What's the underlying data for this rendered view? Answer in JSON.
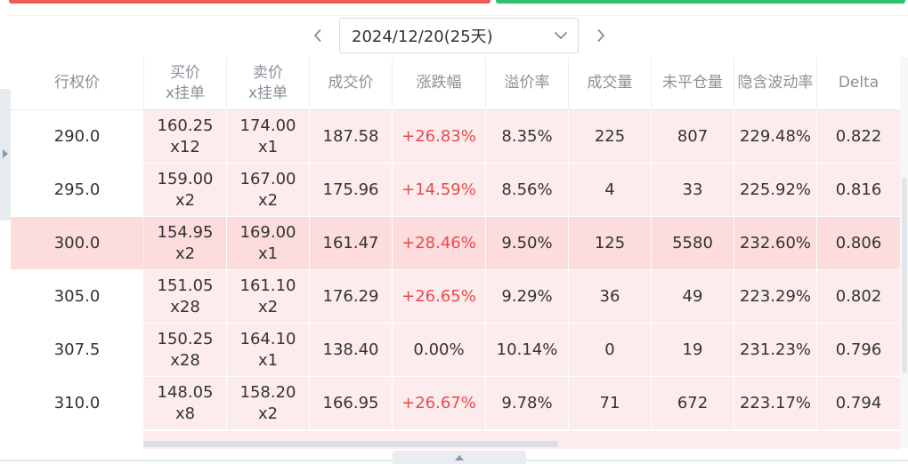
{
  "date_selector": {
    "value": "2024/12/20(25天)"
  },
  "colors": {
    "up": "#e84a4a",
    "row_bg": "#fdeced",
    "atm_bg": "#fcdcdc",
    "header_text": "#8b8f99"
  },
  "icons": {
    "prev": "chevron-left-icon",
    "next": "chevron-right-icon",
    "dropdown": "chevron-down-icon",
    "expand": "caret-up-icon",
    "side": "caret-right-icon"
  },
  "table": {
    "headers": [
      [
        "行权价"
      ],
      [
        "买价",
        "x挂单"
      ],
      [
        "卖价",
        "x挂单"
      ],
      [
        "成交价"
      ],
      [
        "涨跌幅"
      ],
      [
        "溢价率"
      ],
      [
        "成交量"
      ],
      [
        "未平仓量"
      ],
      [
        "隐含波动率"
      ],
      [
        "Delta"
      ]
    ],
    "rows": [
      {
        "strike": "290.0",
        "bid": "160.25",
        "bid_size": "x12",
        "ask": "174.00",
        "ask_size": "x1",
        "last": "187.58",
        "change": "+26.83%",
        "premium": "8.35%",
        "volume": "225",
        "open_interest": "807",
        "iv": "229.48%",
        "delta": "0.822"
      },
      {
        "strike": "295.0",
        "bid": "159.00",
        "bid_size": "x2",
        "ask": "167.00",
        "ask_size": "x2",
        "last": "175.96",
        "change": "+14.59%",
        "premium": "8.56%",
        "volume": "4",
        "open_interest": "33",
        "iv": "225.92%",
        "delta": "0.816"
      },
      {
        "strike": "300.0",
        "bid": "154.95",
        "bid_size": "x2",
        "ask": "169.00",
        "ask_size": "x1",
        "last": "161.47",
        "change": "+28.46%",
        "premium": "9.50%",
        "volume": "125",
        "open_interest": "5580",
        "iv": "232.60%",
        "delta": "0.806"
      },
      {
        "strike": "305.0",
        "bid": "151.05",
        "bid_size": "x28",
        "ask": "161.10",
        "ask_size": "x2",
        "last": "176.29",
        "change": "+26.65%",
        "premium": "9.29%",
        "volume": "36",
        "open_interest": "49",
        "iv": "223.29%",
        "delta": "0.802"
      },
      {
        "strike": "307.5",
        "bid": "150.25",
        "bid_size": "x28",
        "ask": "164.10",
        "ask_size": "x1",
        "last": "138.40",
        "change": "0.00%",
        "premium": "10.14%",
        "volume": "0",
        "open_interest": "19",
        "iv": "231.23%",
        "delta": "0.796"
      },
      {
        "strike": "310.0",
        "bid": "148.05",
        "bid_size": "x8",
        "ask": "158.20",
        "ask_size": "x2",
        "last": "166.95",
        "change": "+26.67%",
        "premium": "9.78%",
        "volume": "71",
        "open_interest": "672",
        "iv": "223.17%",
        "delta": "0.794"
      }
    ]
  }
}
